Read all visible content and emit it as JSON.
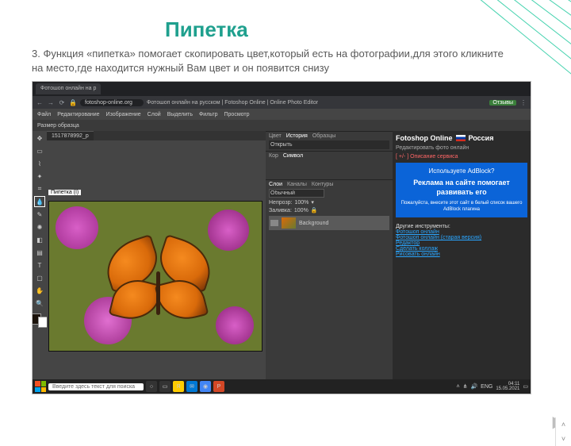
{
  "slide": {
    "title": "Пипетка",
    "desc": "3. Функция «пипетка» помогает скопировать цвет,который есть на фотографии,для этого кликните на место,где находится нужный Вам цвет и он появится снизу"
  },
  "browser": {
    "tab": "Фотошоп онлайн на р",
    "lock": "🔒",
    "url": "fotoshop-online.org",
    "pageTitle": "Фотошоп онлайн на русском | Fotoshop Online | Online Photo Editor",
    "reviews": "Отзывы"
  },
  "menu": [
    "Файл",
    "Редактирование",
    "Изображение",
    "Слой",
    "Выделить",
    "Фильтр",
    "Просмотр"
  ],
  "optrow": "Размер образца",
  "doc": {
    "tab": "1517878992_p",
    "tooltip": "Пипетка (I)"
  },
  "panels": {
    "history": {
      "tabs": [
        "Цвет",
        "История",
        "Образцы"
      ],
      "item": "Открыть"
    },
    "char": {
      "tabs": [
        "Кор",
        "Символ"
      ]
    },
    "layers": {
      "tabs": [
        "Слои",
        "Каналы",
        "Контуры"
      ],
      "mode": "Обычный",
      "opacity_lbl": "Непрозр:",
      "opacity": "100%",
      "fill_lbl": "Заливка:",
      "fill": "100%",
      "layer_name": "Background"
    }
  },
  "side": {
    "brand": "Fotoshop Online",
    "flag_lbl": "Россия",
    "sub": "Редактировать фото онлайн",
    "toggle": "[ +/- ] Описание сервиса",
    "ad": {
      "q": "Используете AdBlock?",
      "big": "Реклама на сайте помогает развивать его",
      "small": "Пожалуйста, внесите этот сайт в белый список вашего AdBlock плагина"
    },
    "tools_hd": "Другие инструменты:",
    "links": [
      "Фотошоп онлайн",
      "Фотошоп онлайн (старая версия)",
      "Редактор",
      "Сделать коллаж",
      "Рисовать онлайн"
    ]
  },
  "taskbar": {
    "search": "Введите здесь текст для поиска",
    "time": "04:11",
    "date": "15.05.2021"
  }
}
